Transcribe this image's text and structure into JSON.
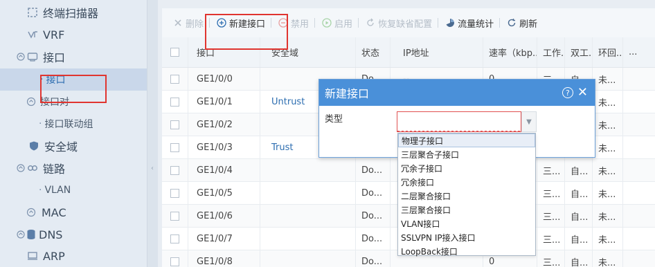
{
  "sidebar": {
    "items": [
      {
        "label": "终端扫描器",
        "icon": "scanner-icon",
        "sub": false
      },
      {
        "label": "VRF",
        "icon": "vrf-icon",
        "sub": false
      },
      {
        "label": "接口",
        "icon": "interface-icon",
        "sub": false
      },
      {
        "label": "接口",
        "icon": "",
        "sub": true,
        "active": true
      },
      {
        "label": "接口对",
        "icon": "interface-pair-icon",
        "sub": false
      },
      {
        "label": "接口联动组",
        "icon": "",
        "sub": true
      },
      {
        "label": "安全域",
        "icon": "shield-icon",
        "sub": false
      },
      {
        "label": "链路",
        "icon": "link-icon",
        "sub": false
      },
      {
        "label": "VLAN",
        "icon": "",
        "sub": true
      },
      {
        "label": "MAC",
        "icon": "mac-icon",
        "sub": false
      },
      {
        "label": "DNS",
        "icon": "dns-icon",
        "sub": false
      },
      {
        "label": "ARP",
        "icon": "arp-icon",
        "sub": false
      }
    ]
  },
  "toolbar": {
    "delete_label": "删除",
    "new_label": "新建接口",
    "disable_label": "禁用",
    "enable_label": "启用",
    "restore_label": "恢复缺省配置",
    "traffic_label": "流量统计",
    "refresh_label": "刷新"
  },
  "table": {
    "headers": [
      "接口",
      "安全域",
      "状态",
      "IP地址",
      "速率（kbp...",
      "工作...",
      "双工...",
      "环回...",
      "..."
    ],
    "rows": [
      {
        "if": "GE1/0/0",
        "zone": "",
        "status": "Do...",
        "ip": "--",
        "rate": "0",
        "work": "三...",
        "dup": "自...",
        "loop": "未..."
      },
      {
        "if": "GE1/0/1",
        "zone": "Untrust",
        "status": "",
        "ip": "",
        "rate": "",
        "work": "",
        "dup": "",
        "loop": "未..."
      },
      {
        "if": "GE1/0/2",
        "zone": "",
        "status": "",
        "ip": "",
        "rate": "",
        "work": "",
        "dup": "",
        "loop": "未..."
      },
      {
        "if": "GE1/0/3",
        "zone": "Trust",
        "status": "",
        "ip": "",
        "rate": "",
        "work": "",
        "dup": "",
        "loop": "未..."
      },
      {
        "if": "GE1/0/4",
        "zone": "",
        "status": "Do...",
        "ip": "",
        "rate": "",
        "work": "三...",
        "dup": "自...",
        "loop": "未..."
      },
      {
        "if": "GE1/0/5",
        "zone": "",
        "status": "Do...",
        "ip": "",
        "rate": "",
        "work": "三...",
        "dup": "自...",
        "loop": "未..."
      },
      {
        "if": "GE1/0/6",
        "zone": "",
        "status": "Do...",
        "ip": "",
        "rate": "",
        "work": "三...",
        "dup": "自...",
        "loop": "未..."
      },
      {
        "if": "GE1/0/7",
        "zone": "",
        "status": "Do...",
        "ip": "",
        "rate": "",
        "work": "三...",
        "dup": "自...",
        "loop": "未..."
      },
      {
        "if": "GE1/0/8",
        "zone": "",
        "status": "Do...",
        "ip": "",
        "rate": "0",
        "work": "三...",
        "dup": "自...",
        "loop": "未..."
      }
    ]
  },
  "dialog": {
    "title": "新建接口",
    "type_label": "类型",
    "type_value": "",
    "options": [
      "物理子接口",
      "三层聚合子接口",
      "冗余子接口",
      "冗余接口",
      "二层聚合接口",
      "三层聚合接口",
      "VLAN接口",
      "SSLVPN IP接入接口",
      "LoopBack接口"
    ],
    "selected_option": "物理子接口"
  },
  "colors": {
    "accent": "#4a90d9",
    "annotation_red": "#e0342f",
    "link_blue": "#2c6db0"
  }
}
